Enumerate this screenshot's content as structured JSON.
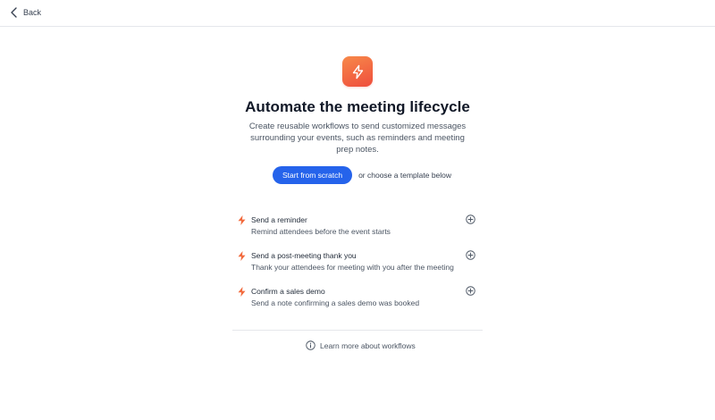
{
  "nav": {
    "back_label": "Back"
  },
  "hero": {
    "icon": "lightning-bolt-icon",
    "title": "Automate the meeting lifecycle",
    "subtitle": "Create reusable workflows to send customized messages surrounding your events, such as reminders and meeting prep notes.",
    "primary_button": "Start from scratch",
    "alt_text": "or choose a template below"
  },
  "templates": [
    {
      "title": "Send a reminder",
      "description": "Remind attendees before the event starts"
    },
    {
      "title": "Send a post-meeting thank you",
      "description": "Thank your attendees for meeting with you after the meeting"
    },
    {
      "title": "Confirm a sales demo",
      "description": "Send a note confirming a sales demo was booked"
    }
  ],
  "footer": {
    "learn_more": "Learn more about workflows",
    "icon": "info-icon"
  },
  "colors": {
    "accent": "#2563eb",
    "bolt": "#f26a3d",
    "icon_gradient_start": "#f7894a",
    "icon_gradient_end": "#ef4d3c"
  }
}
